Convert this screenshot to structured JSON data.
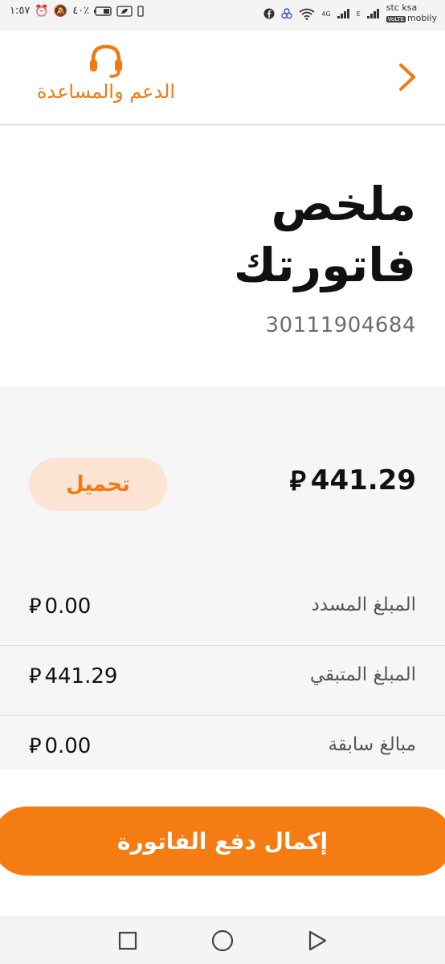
{
  "status_bar": {
    "time": "١:٥٧",
    "battery": "٤٠٪",
    "carrier_1": "stc ksa",
    "carrier_2": "mobily",
    "volte": "VoLTE",
    "network_4g": "4G",
    "network_e": "E"
  },
  "header": {
    "support_label": "الدعم والمساعدة"
  },
  "bill": {
    "title_line1": "ملخص",
    "title_line2": "فاتورتك",
    "number": "30111904684"
  },
  "summary": {
    "total_amount": "441.29",
    "download_label": "تحميل",
    "currency_symbol": "⃁",
    "rows": [
      {
        "label": "المبلغ المسدد",
        "value": "0.00"
      },
      {
        "label": "المبلغ المتبقي",
        "value": "441.29"
      },
      {
        "label": "مبالغ سابقة",
        "value": "0.00"
      }
    ]
  },
  "actions": {
    "pay_label": "إكمال دفع الفاتورة"
  },
  "colors": {
    "accent": "#f57c12",
    "accent_light": "#fbe4d3"
  }
}
